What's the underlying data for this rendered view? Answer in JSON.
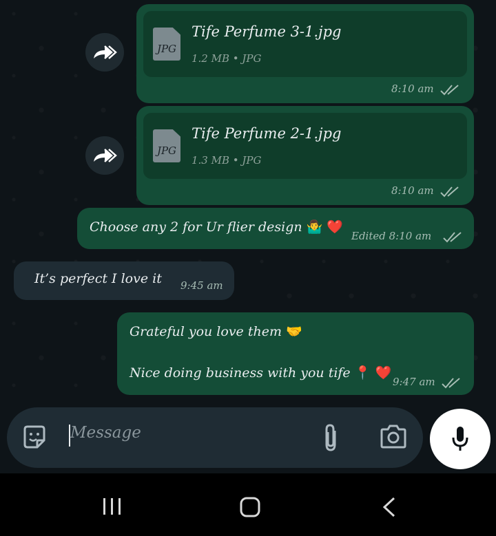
{
  "messages": [
    {
      "type": "file",
      "file_name": "Tife Perfume 3-1.jpg",
      "file_meta": "1.2 MB • JPG",
      "icon_label": "JPG",
      "time": "8:10 am"
    },
    {
      "type": "file",
      "file_name": "Tife Perfume 2-1.jpg",
      "file_meta": "1.3 MB • JPG",
      "icon_label": "JPG",
      "time": "8:10 am"
    },
    {
      "type": "text",
      "text": "Choose any 2 for Ur flier design",
      "emoji": "🤷‍♂️",
      "emoji_2": "❤️",
      "edited_label": "Edited",
      "time": "8:10 am"
    },
    {
      "type": "text_in",
      "text": "It’s perfect I love it",
      "time": "9:45 am"
    },
    {
      "type": "text",
      "line1": "Grateful you love them",
      "line1_emoji": "🤝",
      "line2": "Nice doing business with you tife",
      "line2_emoji": "📍",
      "line2_emoji_2": "❤️",
      "time": "9:47 am"
    }
  ],
  "composer": {
    "placeholder": "Message"
  },
  "icons": [
    "forward-icon",
    "file-icon",
    "double-check-icon",
    "sticker-icon",
    "attach-icon",
    "camera-icon",
    "mic-icon",
    "recents-icon",
    "home-icon",
    "back-icon"
  ],
  "colors": {
    "outgoing_bubble": "#144d37",
    "incoming_bubble": "#1f2c34",
    "background": "#0e1418",
    "check": "#a7bdb4"
  }
}
